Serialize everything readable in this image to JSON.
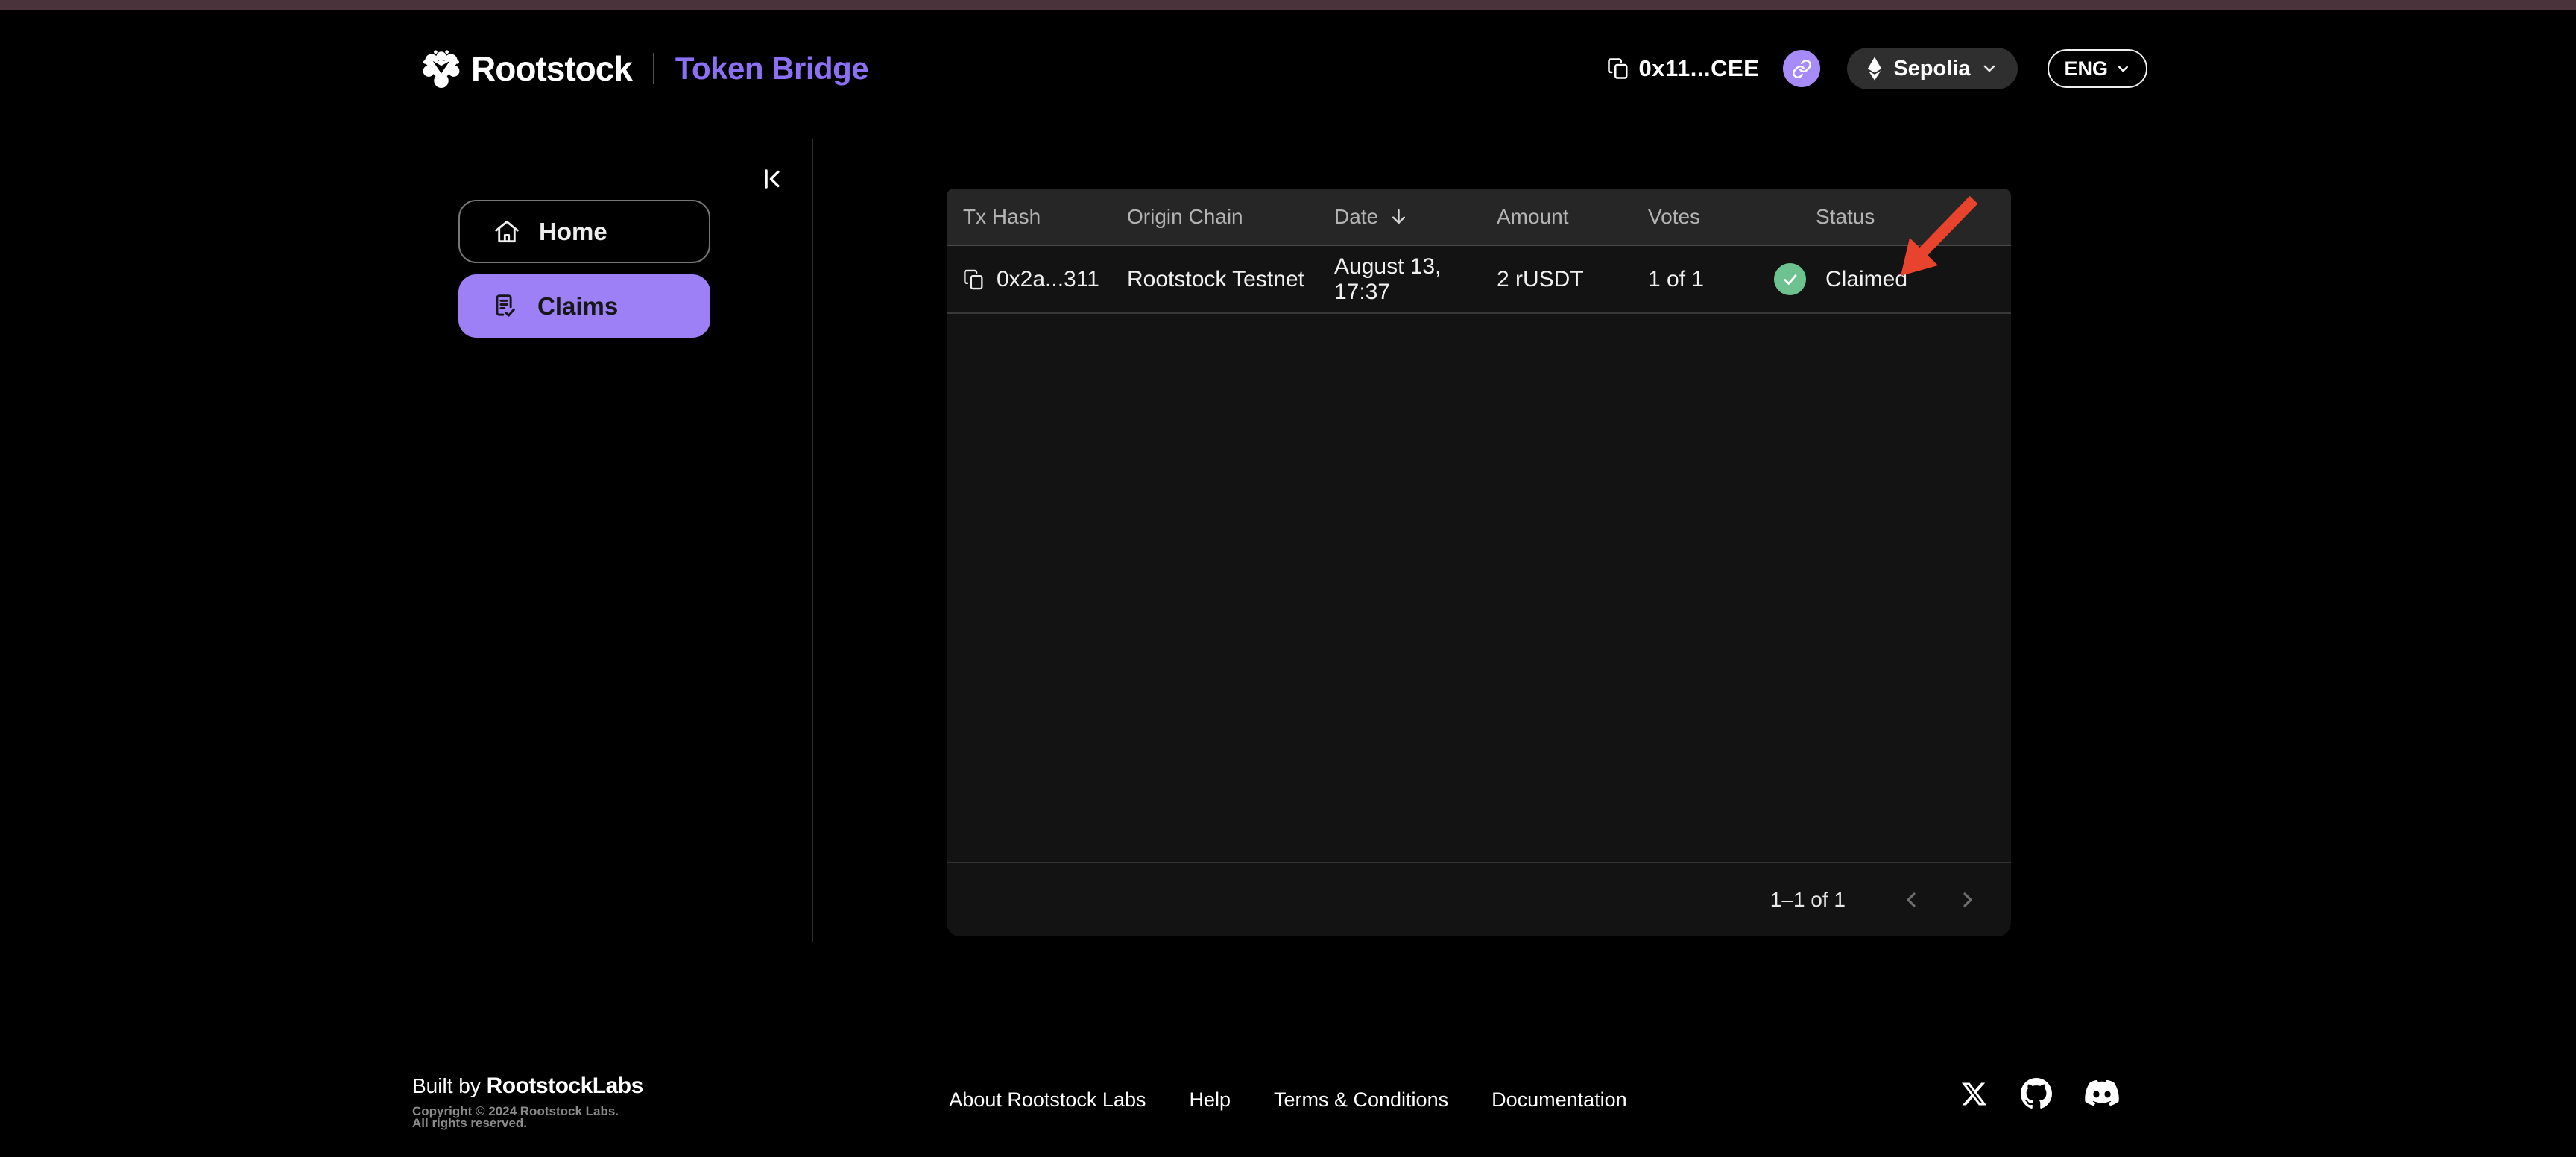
{
  "header": {
    "brand": "Rootstock",
    "app_name": "Token Bridge",
    "wallet_address": "0x11...CEE",
    "network_selector": {
      "label": "Sepolia"
    },
    "language_selector": {
      "label": "ENG"
    }
  },
  "sidebar": {
    "home_label": "Home",
    "claims_label": "Claims"
  },
  "claims_table": {
    "columns": {
      "tx_hash": "Tx Hash",
      "origin_chain": "Origin Chain",
      "date": "Date",
      "amount": "Amount",
      "votes": "Votes",
      "status": "Status"
    },
    "sorted_by": "Date",
    "sort_direction": "descending",
    "rows": [
      {
        "tx_hash": "0x2a...311",
        "origin_chain": "Rootstock Testnet",
        "date": "August 13, 17:37",
        "amount": "2 rUSDT",
        "votes": "1 of 1",
        "status": "Claimed"
      }
    ],
    "pagination": {
      "range_label": "1–1 of 1"
    }
  },
  "footer": {
    "built_by_prefix": "Built by ",
    "built_by_brand": "RootstockLabs",
    "copyright_line_1": "Copyright © 2024 Rootstock Labs.",
    "copyright_line_2": "All rights reserved.",
    "links": [
      "About Rootstock Labs",
      "Help",
      "Terms & Conditions",
      "Documentation"
    ]
  },
  "colors": {
    "accent_purple": "#8c6ff2",
    "button_purple": "#9d80f6",
    "status_green": "#6ec28f",
    "annotation_red": "#e8432c",
    "top_banner": "#4a333a",
    "card_bg": "#131313",
    "table_header_bg": "#262626"
  }
}
